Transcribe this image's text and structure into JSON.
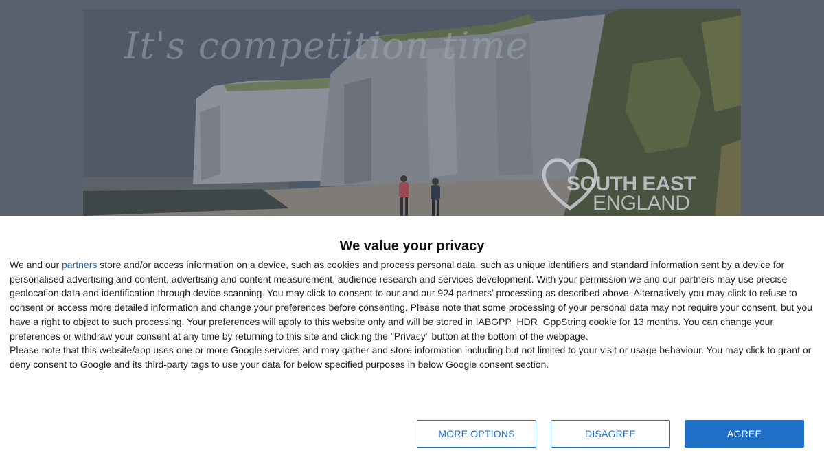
{
  "hero": {
    "tagline": "It's competition time",
    "brand_line1": "SOUTH EAST",
    "brand_line2": "ENGLAND"
  },
  "consent": {
    "title": "We value your privacy",
    "para1_before_link": "We and our ",
    "partners_link": "partners",
    "para1_after_link": " store and/or access information on a device, such as cookies and process personal data, such as unique identifiers and standard information sent by a device for personalised advertising and content, advertising and content measurement, audience research and services development. With your permission we and our partners may use precise geolocation data and identification through device scanning. You may click to consent to our and our 924 partners’ processing as described above. Alternatively you may click to refuse to consent or access more detailed information and change your preferences before consenting. Please note that some processing of your personal data may not require your consent, but you have a right to object to such processing. Your preferences will apply to this website only and will be stored in IABGPP_HDR_GppString cookie for 13 months. You can change your preferences or withdraw your consent at any time by returning to this site and clicking the \"Privacy\" button at the bottom of the webpage.",
    "para2": "Please note that this website/app uses one or more Google services and may gather and store information including but not limited to your visit or usage behaviour. You may click to grant or deny consent to Google and its third-party tags to use your data for below specified purposes in below Google consent section.",
    "buttons": {
      "more_options": "MORE OPTIONS",
      "disagree": "DISAGREE",
      "agree": "AGREE"
    }
  },
  "colors": {
    "accent": "#1e6fc5",
    "overlay": "#59616e"
  },
  "icons": [
    "heart-logo-icon"
  ]
}
